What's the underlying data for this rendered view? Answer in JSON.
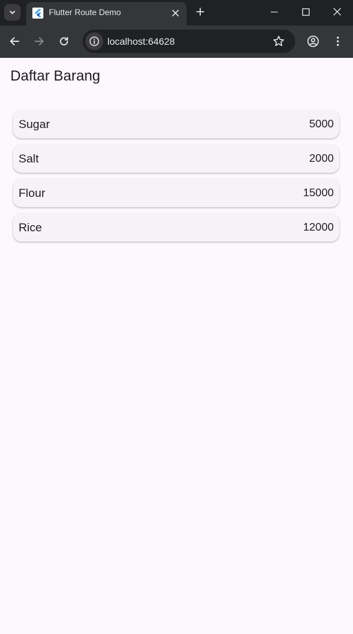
{
  "browser": {
    "tab_title": "Flutter Route Demo",
    "url": "localhost:64628",
    "icons": {
      "tab_list": "chevron-down-icon",
      "favicon": "flutter-icon",
      "tab_close": "close-icon",
      "new_tab": "plus-icon",
      "minimize": "minimize-icon",
      "maximize": "maximize-icon",
      "close_window": "close-icon",
      "back": "arrow-left-icon",
      "forward": "arrow-right-icon",
      "reload": "reload-icon",
      "site_info": "info-icon",
      "bookmark": "star-icon",
      "profile": "profile-icon",
      "menu": "kebab-menu-icon"
    }
  },
  "page": {
    "title": "Daftar Barang",
    "items": [
      {
        "name": "Sugar",
        "value": "5000"
      },
      {
        "name": "Salt",
        "value": "2000"
      },
      {
        "name": "Flour",
        "value": "15000"
      },
      {
        "name": "Rice",
        "value": "12000"
      }
    ]
  },
  "colors": {
    "page_background": "#fdf7fe",
    "card_background": "#f7f2f7",
    "text": "#1d1b20",
    "chrome_dark": "#202124",
    "chrome_toolbar": "#35363a"
  }
}
